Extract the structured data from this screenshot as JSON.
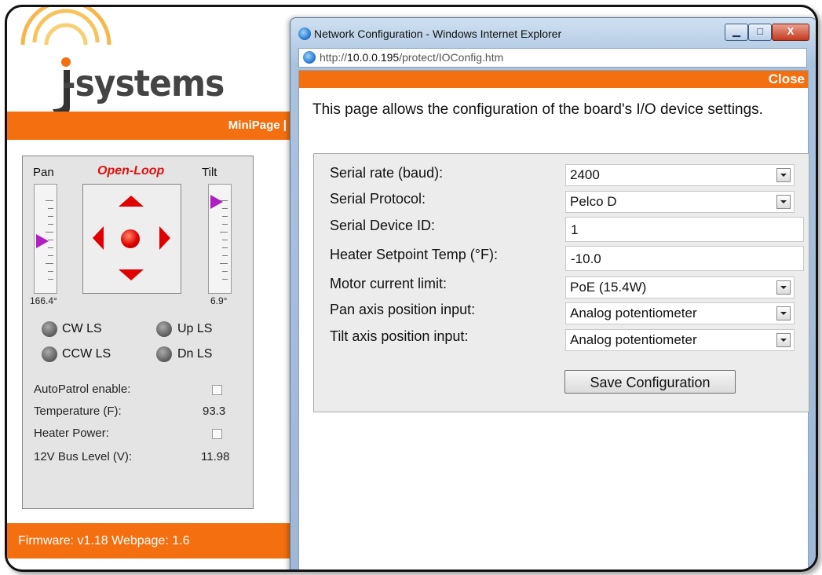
{
  "minipage": {
    "logo_text": "-systems",
    "nav_link": "MiniPage |",
    "pan_label": "Pan",
    "mode_label": "Open-Loop",
    "tilt_label": "Tilt",
    "pan_value": "166.4°",
    "tilt_value": "6.9°",
    "limit_switches": [
      {
        "label": "CW LS"
      },
      {
        "label": "Up LS"
      },
      {
        "label": "CCW LS"
      },
      {
        "label": "Dn LS"
      }
    ],
    "stats": [
      {
        "label": "AutoPatrol enable:",
        "checked": false
      },
      {
        "label": "Temperature (F):",
        "value": "93.3"
      },
      {
        "label": "Heater Power:",
        "checked": false
      },
      {
        "label": "12V Bus Level (V):",
        "value": "11.98"
      }
    ],
    "footer": "Firmware: v1.18  Webpage: 1.6",
    "colors": {
      "accent": "#f36f0f",
      "direction_arrows": "#e00000",
      "slider_marker": "#b020c0"
    }
  },
  "ie_window": {
    "title": "Network Configuration - Windows Internet Explorer",
    "address_prefix": "http://",
    "address_host": "10.0.0.195",
    "address_path": "/protect/IOConfig.htm",
    "close_link": "Close",
    "intro": "This page allows the configuration of the board's I/O device settings.",
    "form": {
      "serial_rate_label": "Serial rate (baud):",
      "serial_rate_value": "2400",
      "serial_protocol_label": "Serial Protocol:",
      "serial_protocol_value": "Pelco D",
      "device_id_label": "Serial Device ID:",
      "device_id_value": "1",
      "heater_label": "Heater Setpoint Temp (°F):",
      "heater_value": "-10.0",
      "motor_label": "Motor current limit:",
      "motor_value": "PoE (15.4W)",
      "pan_input_label": "Pan axis position input:",
      "pan_input_value": "Analog potentiometer",
      "tilt_input_label": "Tilt axis position input:",
      "tilt_input_value": "Analog potentiometer",
      "save_label": "Save Configuration"
    }
  }
}
